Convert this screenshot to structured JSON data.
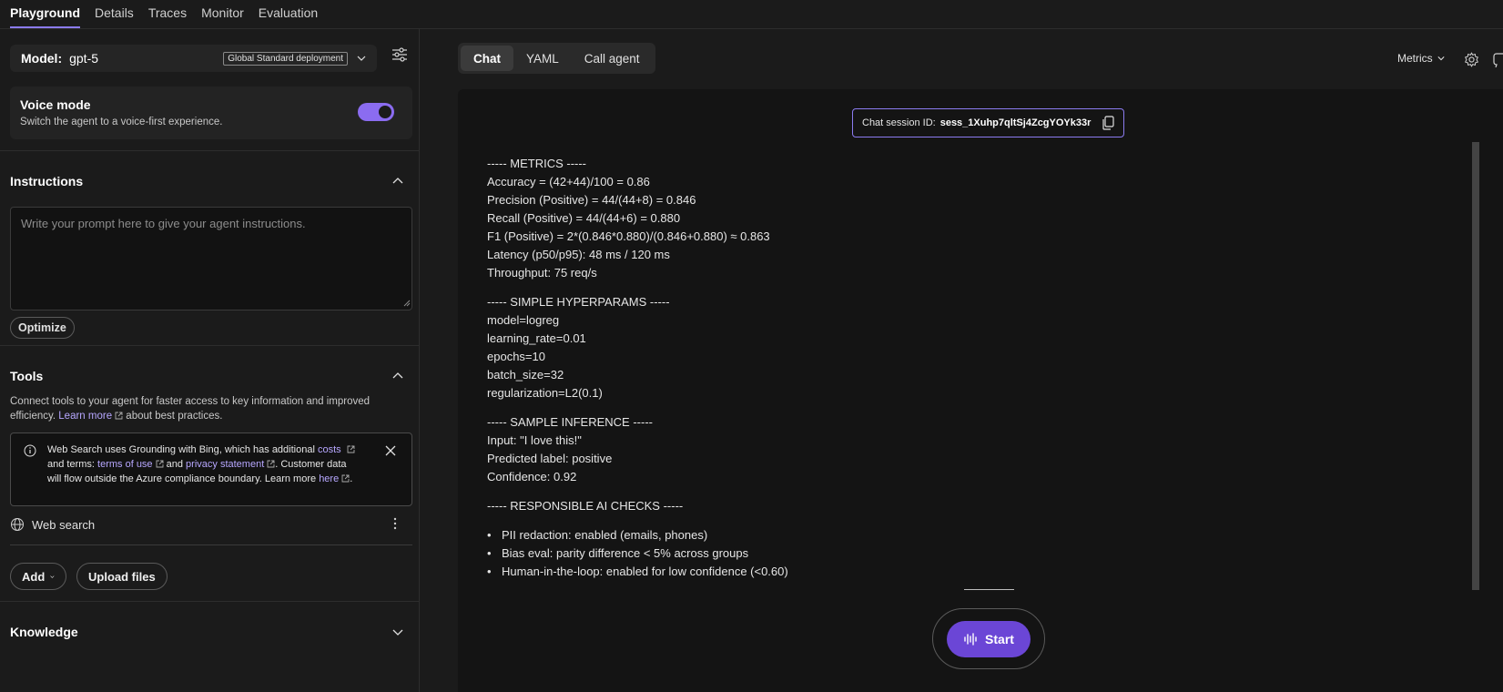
{
  "topnav": {
    "tabs": [
      "Playground",
      "Details",
      "Traces",
      "Monitor",
      "Evaluation"
    ]
  },
  "model": {
    "label": "Model:",
    "value": "gpt-5",
    "deployment": "Global Standard deployment"
  },
  "voice": {
    "title": "Voice mode",
    "subtitle": "Switch the agent to a voice-first experience.",
    "enabled": true
  },
  "instructions": {
    "title": "Instructions",
    "placeholder": "Write your prompt here to give your agent instructions.",
    "optimize_label": "Optimize"
  },
  "tools": {
    "title": "Tools",
    "desc_pre": "Connect tools to your agent for faster access to key information and improved efficiency.",
    "learn_more": "Learn more",
    "desc_post": "about best practices.",
    "notice": {
      "t1": "Web Search uses Grounding with Bing, which has additional",
      "costs": "costs",
      "t2": "and terms:",
      "terms": "terms of use",
      "t3": "and",
      "privacy": "privacy statement",
      "t4": ". Customer data will flow outside the Azure compliance boundary. Learn more",
      "here": "here",
      "t5": "."
    },
    "web_search_label": "Web search",
    "add_label": "Add",
    "upload_label": "Upload files"
  },
  "knowledge": {
    "title": "Knowledge"
  },
  "chat": {
    "tabs": [
      "Chat",
      "YAML",
      "Call agent"
    ],
    "metrics_label": "Metrics",
    "session_label": "Chat session ID:",
    "session_id": "sess_1Xuhp7qltSj4ZcgYOYk33r",
    "lines": [
      "----- METRICS -----",
      "Accuracy = (42+44)/100 = 0.86",
      "Precision (Positive) = 44/(44+8) = 0.846",
      "Recall (Positive) = 44/(44+6) = 0.880",
      "F1 (Positive) = 2*(0.846*0.880)/(0.846+0.880) ≈ 0.863",
      "Latency (p50/p95): 48 ms / 120 ms",
      "Throughput: 75 req/s",
      "----- SIMPLE HYPERPARAMS -----",
      "model=logreg",
      "learning_rate=0.01",
      "epochs=10",
      "batch_size=32",
      "regularization=L2(0.1)",
      "----- SAMPLE INFERENCE -----",
      "Input: \"I love this!\"",
      "Predicted label: positive",
      "Confidence: 0.92",
      "----- RESPONSIBLE AI CHECKS -----"
    ],
    "bullets": [
      "PII redaction: enabled (emails, phones)",
      "Bias eval: parity difference < 5% across groups",
      "Human-in-the-loop: enabled for low confidence (<0.60)"
    ],
    "start_label": "Start"
  },
  "colors": {
    "accent": "#8b6cf0",
    "start": "#6b46d6",
    "link": "#b7a7ff"
  }
}
